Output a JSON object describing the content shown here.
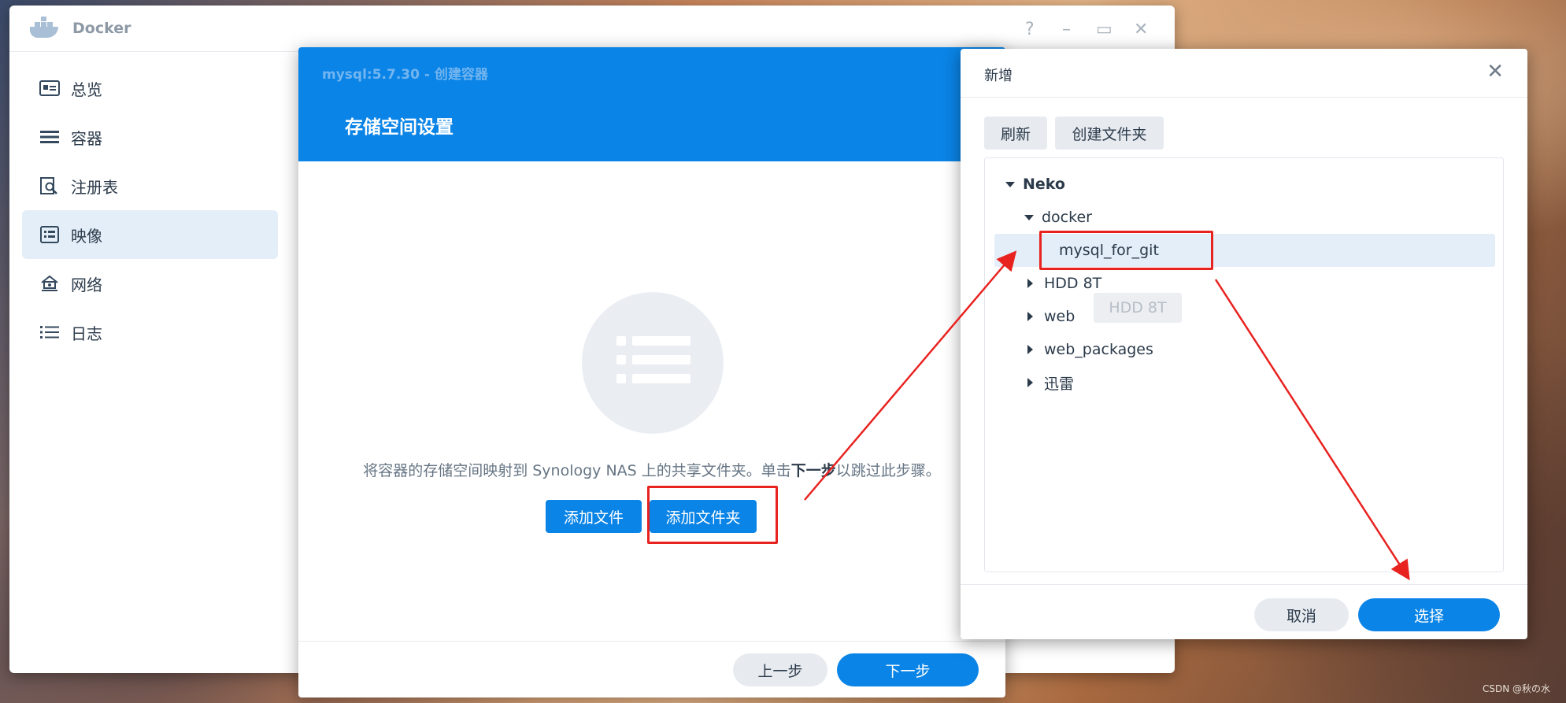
{
  "docker": {
    "title": "Docker",
    "controls": [
      "?",
      "–",
      "▭",
      "✕"
    ],
    "sidebar": [
      {
        "label": "总览",
        "icon": "overview-card-icon"
      },
      {
        "label": "容器",
        "icon": "container-list-icon"
      },
      {
        "label": "注册表",
        "icon": "registry-search-icon"
      },
      {
        "label": "映像",
        "icon": "image-doc-icon",
        "active": true
      },
      {
        "label": "网络",
        "icon": "network-home-icon"
      },
      {
        "label": "日志",
        "icon": "log-list-icon"
      }
    ]
  },
  "wizard": {
    "subtitle": "mysql:5.7.30 - 创建容器",
    "title": "存储空间设置",
    "description_before": "将容器的存储空间映射到 Synology NAS 上的共享文件夹。单击",
    "description_bold": "下一步",
    "description_after": "以跳过此步骤。",
    "add_file": "添加文件",
    "add_folder": "添加文件夹",
    "prev": "上一步",
    "next": "下一步"
  },
  "dialog": {
    "title": "新增",
    "close": "✕",
    "refresh": "刷新",
    "create_folder": "创建文件夹",
    "tree": {
      "root": "Neko",
      "docker": "docker",
      "selected": "mysql_for_git",
      "siblings": [
        "HDD 8T",
        "web",
        "web_packages",
        "迅雷"
      ],
      "tooltip": "HDD 8T"
    },
    "cancel": "取消",
    "select": "选择"
  },
  "watermark": "CSDN @秋の水",
  "colors": {
    "accent": "#0a84e6",
    "annotation": "#e8221f",
    "selection": "#e4eef8"
  }
}
